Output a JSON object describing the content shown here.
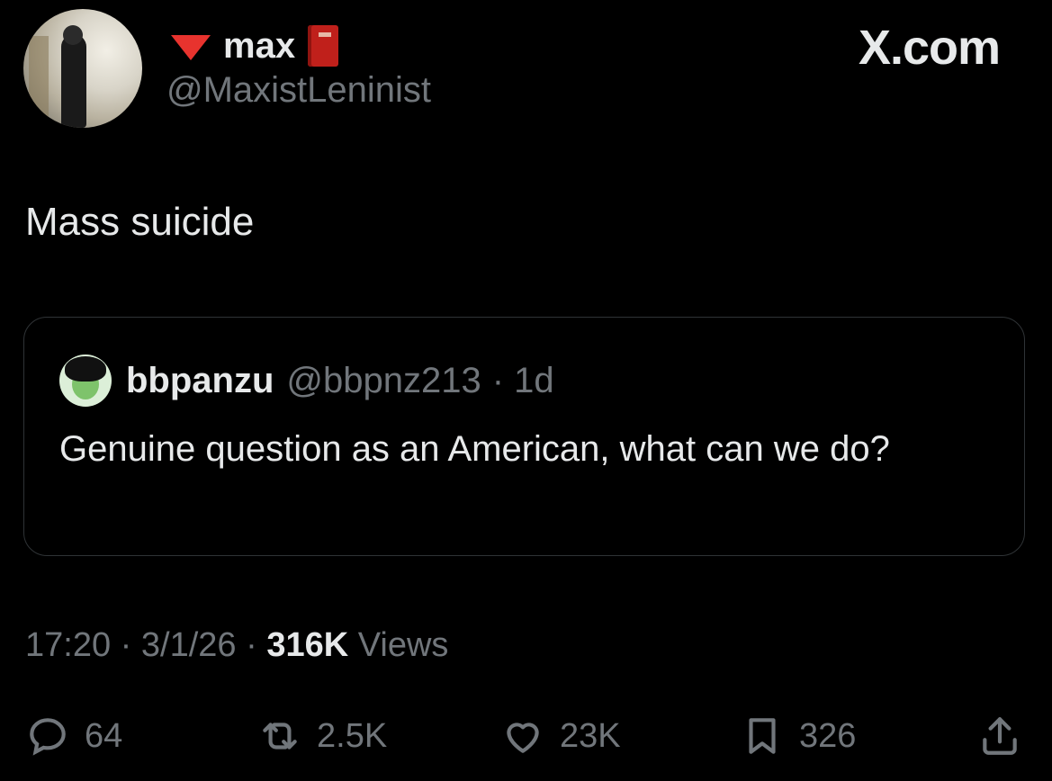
{
  "author": {
    "name": "max",
    "handle": "@MaxistLeninist"
  },
  "brand": {
    "label": "X.com"
  },
  "post": {
    "text": "Mass suicide"
  },
  "quoted": {
    "name": "bbpanzu",
    "handle": "@bbpnz213",
    "time": "· 1d",
    "text": "Genuine question as an American, what can we do?"
  },
  "meta": {
    "time": "17:20",
    "sep1": " · ",
    "date": "3/1/26",
    "sep2": " · ",
    "views": "316K",
    "views_label": " Views"
  },
  "actions": {
    "replies": "64",
    "reposts": "2.5K",
    "likes": "23K",
    "bookmarks": "326"
  },
  "colors": {
    "background": "#000000",
    "text": "#e7e9ea",
    "secondary": "#71767b",
    "border": "#2f3336",
    "triangle": "#e8332e"
  }
}
